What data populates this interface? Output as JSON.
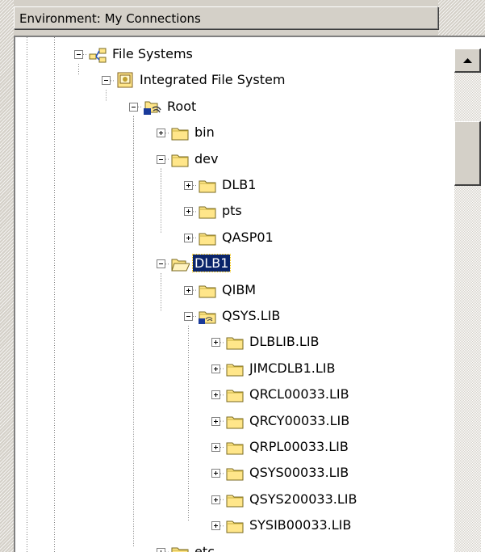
{
  "environment": {
    "title": "Environment: My Connections"
  },
  "tree": {
    "nodes": [
      {
        "label": "File Systems",
        "icon": "network-icon",
        "expander": "minus"
      },
      {
        "label": "Integrated File System",
        "icon": "file-system-icon",
        "expander": "minus"
      },
      {
        "label": "Root",
        "icon": "root-icon",
        "expander": "minus"
      },
      {
        "label": "bin",
        "icon": "folder-icon",
        "expander": "plus"
      },
      {
        "label": "dev",
        "icon": "folder-icon",
        "expander": "minus"
      },
      {
        "label": "DLB1",
        "icon": "folder-icon",
        "expander": "plus"
      },
      {
        "label": "pts",
        "icon": "folder-icon",
        "expander": "plus"
      },
      {
        "label": "QASP01",
        "icon": "folder-icon",
        "expander": "plus"
      },
      {
        "label": "DLB1",
        "icon": "open-folder-icon",
        "expander": "minus",
        "selected": true
      },
      {
        "label": "QIBM",
        "icon": "folder-icon",
        "expander": "plus"
      },
      {
        "label": "QSYS.LIB",
        "icon": "library-folder-icon",
        "expander": "minus"
      },
      {
        "label": "DLBLIB.LIB",
        "icon": "folder-icon",
        "expander": "plus"
      },
      {
        "label": "JIMCDLB1.LIB",
        "icon": "folder-icon",
        "expander": "plus"
      },
      {
        "label": "QRCL00033.LIB",
        "icon": "folder-icon",
        "expander": "plus"
      },
      {
        "label": "QRCY00033.LIB",
        "icon": "folder-icon",
        "expander": "plus"
      },
      {
        "label": "QRPL00033.LIB",
        "icon": "folder-icon",
        "expander": "plus"
      },
      {
        "label": "QSYS00033.LIB",
        "icon": "folder-icon",
        "expander": "plus"
      },
      {
        "label": "QSYS200033.LIB",
        "icon": "folder-icon",
        "expander": "plus"
      },
      {
        "label": "SYSIB00033.LIB",
        "icon": "folder-icon",
        "expander": "plus"
      },
      {
        "label": "etc",
        "icon": "folder-icon",
        "expander": "plus"
      }
    ]
  },
  "scrollbar": {
    "up_icon": "scroll-up-arrow-icon"
  },
  "colors": {
    "selection": "#0a246a",
    "window": "#d4d0c8",
    "folder": "#ffe68a"
  }
}
